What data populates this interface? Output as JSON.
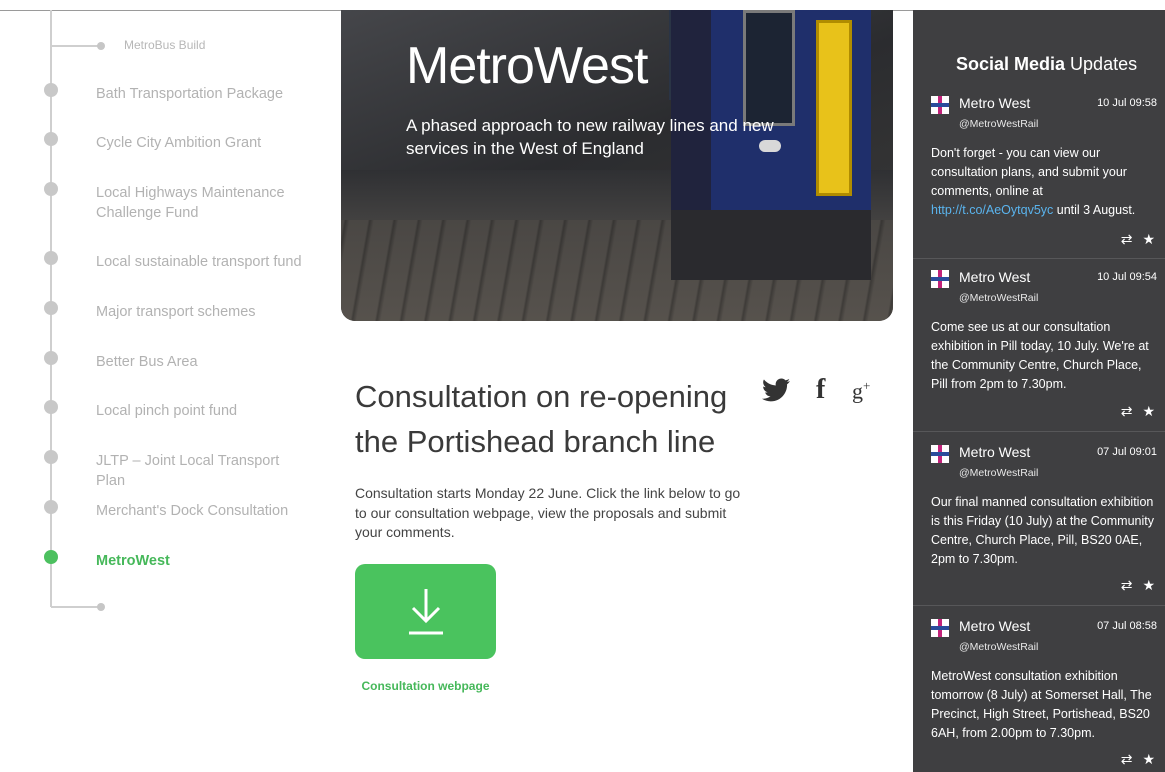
{
  "nav": {
    "sub_item": "MetroBus Build",
    "items": [
      {
        "label": "Bath Transportation Package"
      },
      {
        "label": "Cycle City Ambition Grant"
      },
      {
        "label": "Local Highways Maintenance Challenge Fund"
      },
      {
        "label": "Local sustainable transport fund"
      },
      {
        "label": "Major transport schemes"
      },
      {
        "label": "Better Bus Area"
      },
      {
        "label": "Local pinch point fund"
      },
      {
        "label": "JLTP – Joint Local Transport Plan"
      },
      {
        "label": "Merchant's Dock Consultation"
      },
      {
        "label": "MetroWest"
      }
    ],
    "active_item": "MetroWest"
  },
  "hero": {
    "title": "MetroWest",
    "subtitle": "A phased approach to new railway lines and new services in the West of England"
  },
  "main": {
    "heading": "Consultation on re-opening the Portishead branch line",
    "intro": "Consultation starts Monday 22 June. Click the link below to go to our consultation webpage, view the proposals and submit your comments.",
    "download_label": "Consultation webpage",
    "share_icons": [
      "twitter-icon",
      "facebook-icon",
      "google-plus-icon"
    ]
  },
  "feed": {
    "title_bold": "Social Media",
    "title_rest": " Updates",
    "tweets": [
      {
        "name": "Metro West",
        "handle": "@MetroWestRail",
        "time": "10 Jul 09:58",
        "text_before": "Don't forget - you can view our consultation plans, and submit your comments, online at ",
        "link": "http://t.co/AeOytqv5yc",
        "text_after": " until 3 August."
      },
      {
        "name": "Metro West",
        "handle": "@MetroWestRail",
        "time": "10 Jul 09:54",
        "text": "Come see us at our consultation exhibition in Pill today, 10 July. We're at the Community Centre, Church Place, Pill from 2pm to 7.30pm."
      },
      {
        "name": "Metro West",
        "handle": "@MetroWestRail",
        "time": "07 Jul 09:01",
        "text": "Our final manned consultation exhibition is this Friday (10 July) at the Community Centre, Church Place, Pill, BS20 0AE, 2pm to 7.30pm."
      },
      {
        "name": "Metro West",
        "handle": "@MetroWestRail",
        "time": "07 Jul 08:58",
        "text": "MetroWest consultation exhibition tomorrow (8 July) at Somerset Hall, The Precinct, High Street, Portishead, BS20 6AH, from 2.00pm to 7.30pm."
      }
    ],
    "actions": {
      "retweet": "⇄",
      "favorite": "★"
    }
  },
  "colors": {
    "accent_green": "#4ac35e",
    "feed_bg": "#3f3f41",
    "link_blue": "#5ab4ee",
    "nav_gray": "#b2b2b2"
  }
}
